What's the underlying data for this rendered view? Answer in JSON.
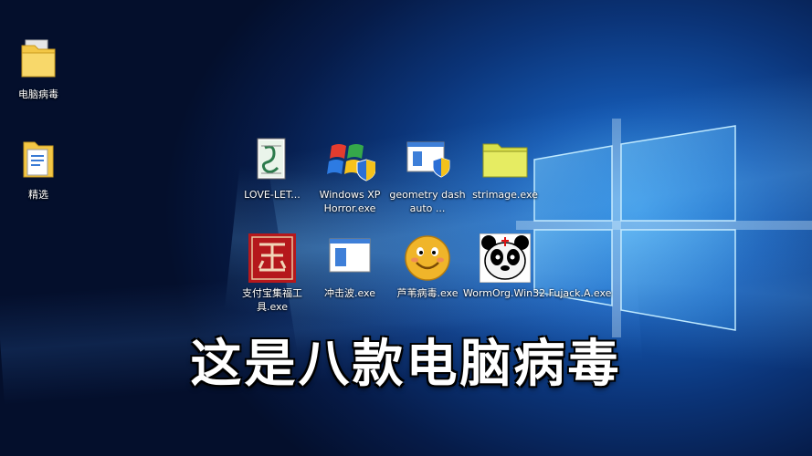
{
  "desktop": {
    "left_icons": [
      {
        "label": "电脑病毒",
        "icon": "folder-icon"
      },
      {
        "label": "精选",
        "icon": "folder-document-icon"
      }
    ],
    "grid_icons": [
      {
        "label": "LOVE-LET...",
        "icon": "script-icon"
      },
      {
        "label": "Windows XP Horror.exe",
        "icon": "windows-flag-shield-icon"
      },
      {
        "label": "geometry dash auto ...",
        "icon": "app-window-shield-icon"
      },
      {
        "label": "strimage.exe",
        "icon": "yellow-folder-icon"
      },
      {
        "label": "支付宝集福工具.exe",
        "icon": "red-seal-icon"
      },
      {
        "label": "冲击波.exe",
        "icon": "app-window-icon"
      },
      {
        "label": "芦苇病毒.exe",
        "icon": "smiley-face-icon"
      },
      {
        "label": "WormOrg.Win32.Fujack.A.exe",
        "icon": "panda-icon"
      }
    ]
  },
  "caption": "这是八款电脑病毒",
  "colors": {
    "background_dark": "#061b48",
    "background_light": "#2f8de0",
    "caption_text": "#ffffff"
  }
}
